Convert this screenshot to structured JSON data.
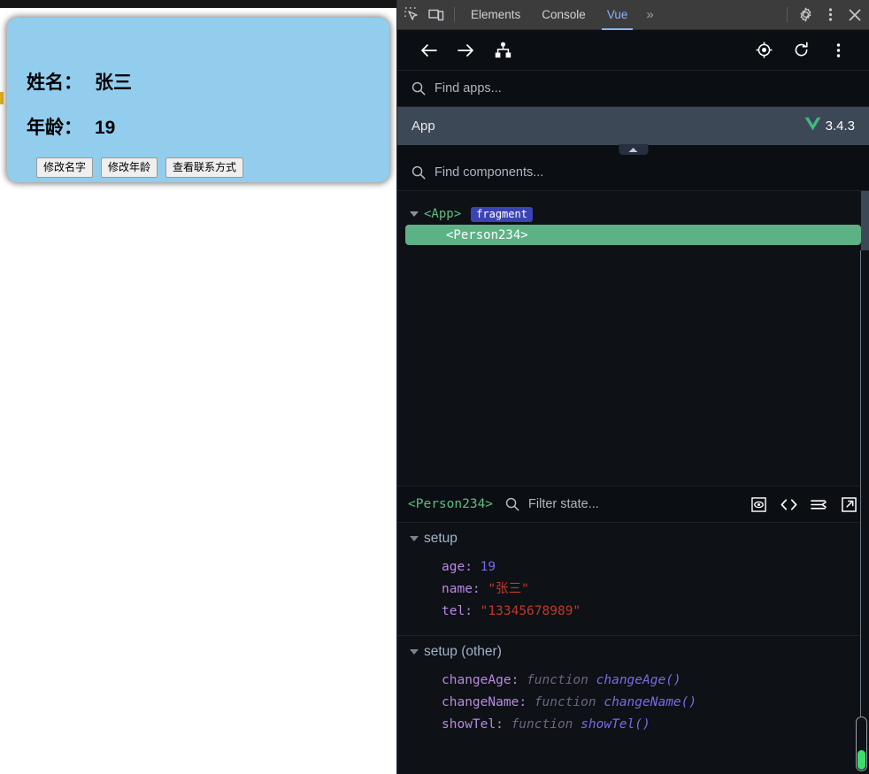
{
  "page": {
    "card": {
      "name_label": "姓名：",
      "name_value": "张三",
      "age_label": "年龄：",
      "age_value": "19",
      "buttons": [
        {
          "label": "修改名字"
        },
        {
          "label": "修改年龄"
        },
        {
          "label": "查看联系方式"
        }
      ],
      "background_color": "#92cdee"
    }
  },
  "devtools": {
    "tabs": [
      {
        "label": "Elements",
        "active": false
      },
      {
        "label": "Console",
        "active": false
      },
      {
        "label": "Vue",
        "active": true
      }
    ],
    "more_tabs_label": "»",
    "icons": {
      "inspect": "inspect-element-icon",
      "device": "device-toolbar-icon",
      "settings": "gear-icon",
      "kebab": "more-options-icon",
      "close": "close-icon"
    },
    "accent_color": "#8ab4f8"
  },
  "vue_toolbar": {
    "back": "back-arrow-icon",
    "forward": "forward-arrow-icon",
    "tree": "component-tree-icon",
    "target": "select-component-icon",
    "refresh": "refresh-icon",
    "kebab": "more-options-icon"
  },
  "app_search": {
    "placeholder": "Find apps..."
  },
  "app_row": {
    "name": "App",
    "version": "3.4.3",
    "logo": "vue-logo-icon",
    "logo_color": "#42b883"
  },
  "component_search": {
    "placeholder": "Find components..."
  },
  "tree": {
    "root": {
      "label": "<App>",
      "badge": "fragment"
    },
    "selected": {
      "label": "<Person234>"
    },
    "selected_color": "#5cb285"
  },
  "state_header": {
    "component": "<Person234>",
    "filter_placeholder": "Filter state...",
    "actions": [
      {
        "name": "inspect-dom-icon"
      },
      {
        "name": "open-in-editor-icon"
      },
      {
        "name": "collapse-all-icon"
      },
      {
        "name": "open-external-icon"
      }
    ]
  },
  "state": {
    "sections": [
      {
        "title": "setup",
        "entries": [
          {
            "key": "age",
            "value": "19",
            "kind": "number"
          },
          {
            "key": "name",
            "value": "\"张三\"",
            "kind": "string"
          },
          {
            "key": "tel",
            "value": "\"13345678989\"",
            "kind": "string"
          }
        ]
      },
      {
        "title": "setup (other)",
        "entries": [
          {
            "key": "changeAge",
            "kw": "function",
            "fn": "changeAge()",
            "kind": "function"
          },
          {
            "key": "changeName",
            "kw": "function",
            "fn": "changeName()",
            "kind": "function"
          },
          {
            "key": "showTel",
            "kw": "function",
            "fn": "showTel()",
            "kind": "function"
          }
        ]
      }
    ]
  },
  "scrollbar": {
    "thumb_color": "#3ddc6e"
  }
}
